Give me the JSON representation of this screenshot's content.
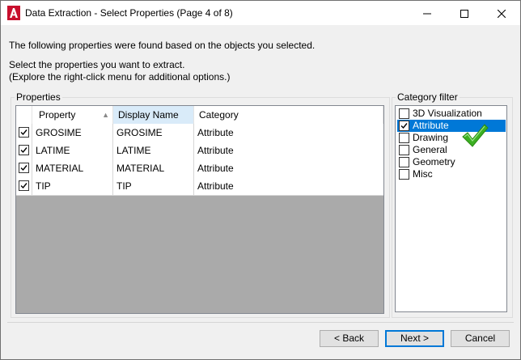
{
  "window": {
    "title": "Data Extraction - Select Properties (Page 4 of 8)",
    "minimize_glyph": "—",
    "maximize_glyph": "☐",
    "close_glyph": "✕",
    "app_icon": "autocad-a-icon",
    "app_icon_color": "#c8102e"
  },
  "intro": {
    "line1": "The following properties were found based on the objects you selected.",
    "line2": "Select the properties you want to extract.",
    "line3": "(Explore the right-click menu for additional options.)"
  },
  "properties": {
    "group_label": "Properties",
    "columns": {
      "property": "Property",
      "display_name": "Display Name",
      "category": "Category"
    },
    "rows": [
      {
        "checked": true,
        "property": "GROSIME",
        "display_name": "GROSIME",
        "category": "Attribute"
      },
      {
        "checked": true,
        "property": "LATIME",
        "display_name": "LATIME",
        "category": "Attribute"
      },
      {
        "checked": true,
        "property": "MATERIAL",
        "display_name": "MATERIAL",
        "category": "Attribute"
      },
      {
        "checked": true,
        "property": "TIP",
        "display_name": "TIP",
        "category": "Attribute"
      }
    ]
  },
  "category_filter": {
    "group_label": "Category filter",
    "items": [
      {
        "label": "3D Visualization",
        "checked": false,
        "selected": false
      },
      {
        "label": "Attribute",
        "checked": true,
        "selected": true
      },
      {
        "label": "Drawing",
        "checked": false,
        "selected": false
      },
      {
        "label": "General",
        "checked": false,
        "selected": false
      },
      {
        "label": "Geometry",
        "checked": false,
        "selected": false
      },
      {
        "label": "Misc",
        "checked": false,
        "selected": false
      }
    ],
    "annotation_icon": "green-checkmark-icon",
    "annotation_color": "#3cb022"
  },
  "buttons": {
    "back": "< Back",
    "next": "Next >",
    "cancel": "Cancel"
  },
  "colors": {
    "selection": "#0078d7",
    "header_selected": "#d9ebf9",
    "grid_empty": "#aaaaaa"
  }
}
